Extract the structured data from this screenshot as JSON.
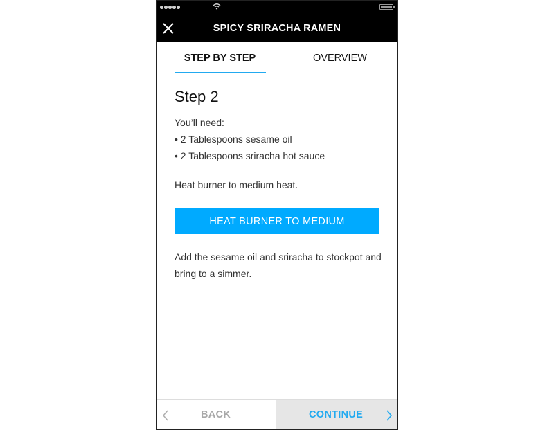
{
  "statusbar": {
    "signal_icon": "signal-dots-icon",
    "wifi_icon": "wifi-icon",
    "battery_icon": "battery-icon"
  },
  "header": {
    "title": "SPICY SRIRACHA RAMEN",
    "close_icon": "close-icon"
  },
  "tabs": [
    {
      "label": "STEP BY STEP",
      "active": true
    },
    {
      "label": "OVERVIEW",
      "active": false
    }
  ],
  "accent_color": "#00aaff",
  "step": {
    "title": "Step 2",
    "needs_label": "You’ll need:",
    "ingredients": [
      "• 2 Tablespoons sesame oil",
      "• 2 Tablespoons sriracha hot sauce"
    ],
    "instruction_1": "Heat burner to medium heat.",
    "action_button": "HEAT BURNER TO MEDIUM",
    "instruction_2": "Add the sesame oil and sriracha to stockpot and bring to a simmer."
  },
  "footer": {
    "back_label": "BACK",
    "continue_label": "CONTINUE"
  }
}
